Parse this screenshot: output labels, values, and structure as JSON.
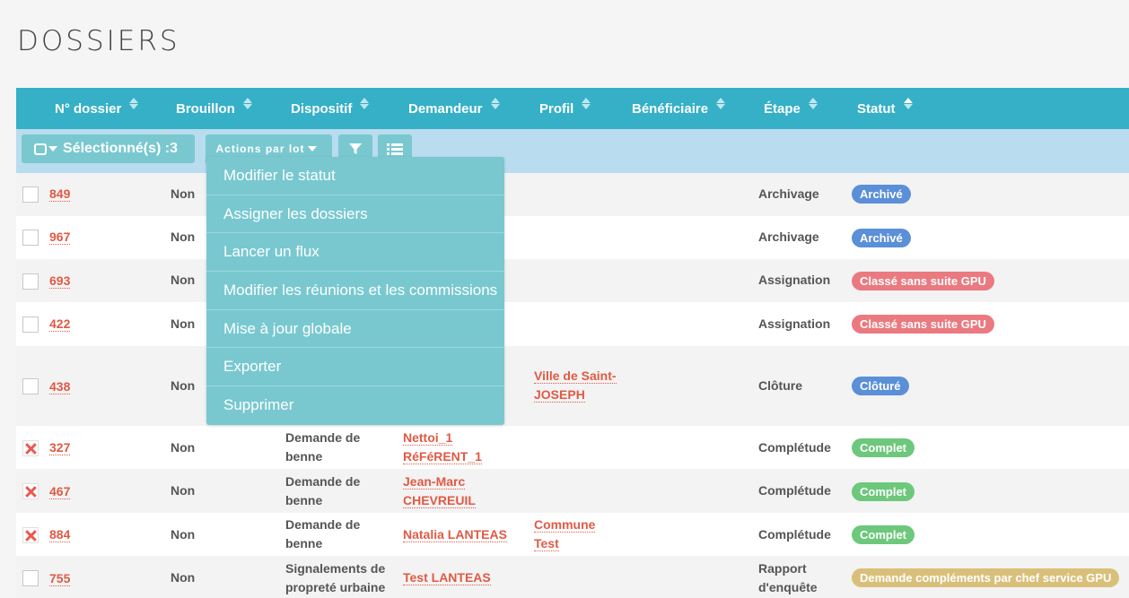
{
  "page": {
    "title": "DOSSIERS"
  },
  "table": {
    "columns": [
      "N° dossier",
      "Brouillon",
      "Dispositif",
      "Demandeur",
      "Profil",
      "Bénéficiaire",
      "Étape",
      "Statut"
    ],
    "rows": [
      {
        "id": "849",
        "brouillon": "Non",
        "dispositif": [
          "",
          ""
        ],
        "demandeur": [
          "",
          ""
        ],
        "beneficiaire": [
          "",
          ""
        ],
        "etape": [
          "Archivage",
          ""
        ],
        "statut": "Archivé",
        "checked": false
      },
      {
        "id": "967",
        "brouillon": "Non",
        "dispositif": [
          "",
          ""
        ],
        "demandeur": [
          "",
          ""
        ],
        "beneficiaire": [
          "",
          ""
        ],
        "etape": [
          "Archivage",
          ""
        ],
        "statut": "Archivé",
        "checked": false
      },
      {
        "id": "693",
        "brouillon": "Non",
        "dispositif": [
          "",
          ""
        ],
        "demandeur": [
          "",
          ""
        ],
        "beneficiaire": [
          "",
          ""
        ],
        "etape": [
          "Assignation",
          ""
        ],
        "statut": "Classé sans suite GPU",
        "checked": false
      },
      {
        "id": "422",
        "brouillon": "Non",
        "dispositif": [
          "",
          ""
        ],
        "demandeur": [
          "",
          ""
        ],
        "beneficiaire": [
          "",
          ""
        ],
        "etape": [
          "Assignation",
          ""
        ],
        "statut": "Classé sans suite GPU",
        "checked": false
      },
      {
        "id": "438",
        "brouillon": "Non",
        "dispositif": [
          "",
          ""
        ],
        "demandeur": [
          "",
          ""
        ],
        "beneficiaire": [
          "Ville de Saint-",
          "JOSEPH"
        ],
        "etape": [
          "Clôture",
          ""
        ],
        "statut": "Clôturé",
        "checked": false
      },
      {
        "id": "327",
        "brouillon": "Non",
        "dispositif": [
          "Demande de",
          "benne"
        ],
        "demandeur": [
          "Nettoi_1",
          "RéFéRENT_1"
        ],
        "beneficiaire": [
          "",
          ""
        ],
        "etape": [
          "Complétude",
          ""
        ],
        "statut": "Complet",
        "checked": true
      },
      {
        "id": "467",
        "brouillon": "Non",
        "dispositif": [
          "Demande de",
          "benne"
        ],
        "demandeur": [
          "Jean-Marc",
          "CHEVREUIL"
        ],
        "beneficiaire": [
          "",
          ""
        ],
        "etape": [
          "Complétude",
          ""
        ],
        "statut": "Complet",
        "checked": true
      },
      {
        "id": "884",
        "brouillon": "Non",
        "dispositif": [
          "Demande de",
          "benne"
        ],
        "demandeur": [
          "Natalia LANTEAS",
          ""
        ],
        "beneficiaire": [
          "Commune",
          "Test"
        ],
        "etape": [
          "Complétude",
          ""
        ],
        "statut": "Complet",
        "checked": true
      },
      {
        "id": "755",
        "brouillon": "Non",
        "dispositif": [
          "Signalements de",
          "propreté urbaine"
        ],
        "demandeur": [
          "Test LANTEAS",
          ""
        ],
        "beneficiaire": [
          "",
          ""
        ],
        "etape": [
          "Rapport",
          "d'enquête"
        ],
        "statut": "Demande compléments par chef service GPU",
        "checked": false
      }
    ]
  },
  "toolbar": {
    "selected_label": "Sélectionné(s) :3",
    "actions_label": "Actions par lot",
    "filter_icon": "filter-icon",
    "list_icon": "list-icon"
  },
  "dropdown": {
    "items": [
      "Modifier le statut",
      "Assigner les dossiers",
      "Lancer un flux",
      "Modifier les réunions et les commissions",
      "Mise à jour globale",
      "Exporter",
      "Supprimer"
    ]
  },
  "colors": {
    "header": "#35b0c7",
    "toolbar": "#b9dcee",
    "button": "#79c8d0",
    "link": "#e05a44",
    "status_archive": "#5b8fd8",
    "status_classe": "#ea7a80",
    "status_complet": "#6dc87c",
    "status_demande": "#d9c07a"
  }
}
